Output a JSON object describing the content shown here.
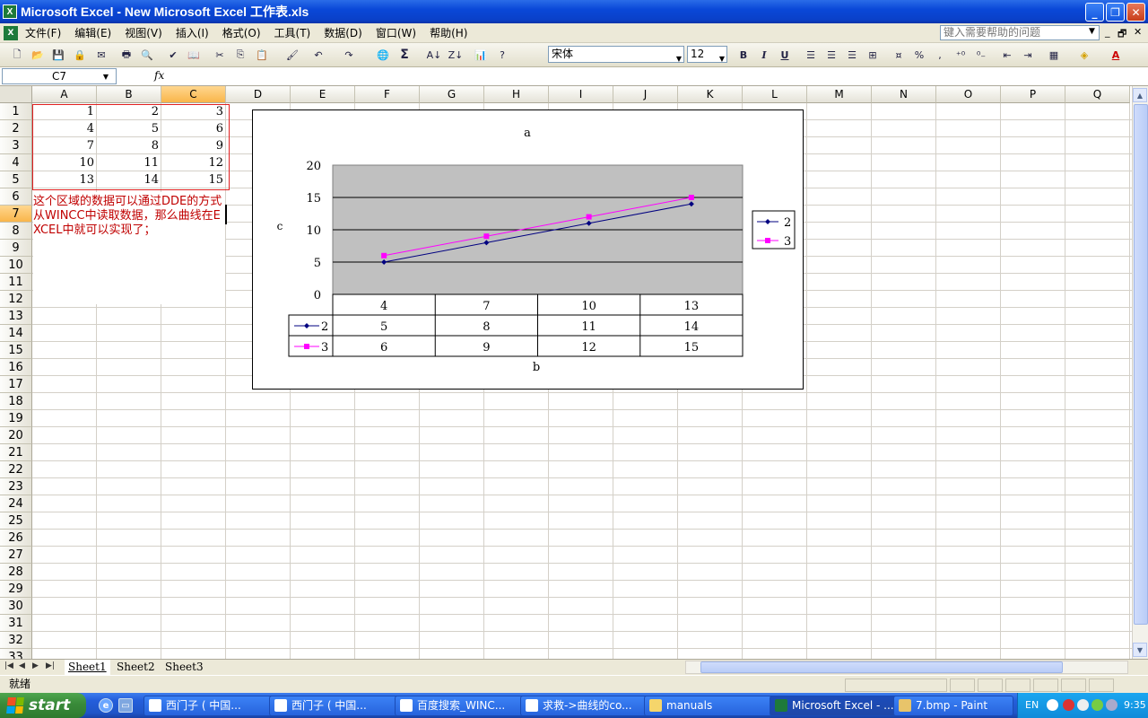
{
  "window": {
    "title": "Microsoft Excel - New Microsoft Excel 工作表.xls",
    "minimize": "_",
    "maximize": "❐",
    "close": "✕"
  },
  "menu": {
    "items": [
      "文件(F)",
      "编辑(E)",
      "视图(V)",
      "插入(I)",
      "格式(O)",
      "工具(T)",
      "数据(D)",
      "窗口(W)",
      "帮助(H)"
    ],
    "help_placeholder": "键入需要帮助的问题",
    "doc_minimize": "_",
    "doc_restore": "🗗",
    "doc_close": "✕"
  },
  "format": {
    "font": "宋体",
    "size": "12",
    "bold": "B",
    "italic": "I",
    "underline": "U",
    "percent": "%",
    "comma": ","
  },
  "formula": {
    "name_box": "C7",
    "fx": "fx",
    "value": ""
  },
  "sheet": {
    "columns": [
      "A",
      "B",
      "C",
      "D",
      "E",
      "F",
      "G",
      "H",
      "I",
      "J",
      "K",
      "L",
      "M",
      "N",
      "O",
      "P",
      "Q"
    ],
    "selected_column": "C",
    "selected_row": "7",
    "rows": [
      "1",
      "2",
      "3",
      "4",
      "5",
      "6",
      "7",
      "8",
      "9",
      "10",
      "11",
      "12",
      "13",
      "14",
      "15",
      "16",
      "17",
      "18",
      "19",
      "20",
      "21",
      "22",
      "23",
      "24",
      "25",
      "26",
      "27",
      "28",
      "29",
      "30",
      "31",
      "32",
      "33"
    ],
    "cells": [
      [
        "1",
        "2",
        "3"
      ],
      [
        "4",
        "5",
        "6"
      ],
      [
        "7",
        "8",
        "9"
      ],
      [
        "10",
        "11",
        "12"
      ],
      [
        "13",
        "14",
        "15"
      ]
    ],
    "note": "这个区域的数据可以通过DDE的方式从WINCC中读取数据，那么曲线在EXCEL中就可以实现了；"
  },
  "chart_data": {
    "type": "line",
    "title": "a",
    "xlabel": "b",
    "ylabel": "c",
    "categories": [
      "4",
      "7",
      "10",
      "13"
    ],
    "series": [
      {
        "name": "2",
        "values": [
          5,
          8,
          11,
          14
        ],
        "color": "#000080",
        "marker": "diamond"
      },
      {
        "name": "3",
        "values": [
          6,
          9,
          12,
          15
        ],
        "color": "#ff00ff",
        "marker": "square"
      }
    ],
    "ylim": [
      0,
      20
    ],
    "yticks": [
      "0",
      "5",
      "10",
      "15",
      "20"
    ],
    "grid": true,
    "data_table": true,
    "legend": "right",
    "plot_background": "#c0c0c0"
  },
  "tabs": {
    "sheets": [
      "Sheet1",
      "Sheet2",
      "Sheet3"
    ],
    "active": "Sheet1"
  },
  "status": {
    "text": "就绪"
  },
  "taskbar": {
    "start": "start",
    "tasks": [
      "西门子 ( 中国...",
      "西门子 ( 中国...",
      "百度搜索_WINC...",
      "求救->曲线的co...",
      "manuals",
      "Microsoft Excel - ...",
      "7.bmp - Paint"
    ],
    "active_task": "Microsoft Excel - ...",
    "lang": "EN",
    "clock": "9:35"
  }
}
